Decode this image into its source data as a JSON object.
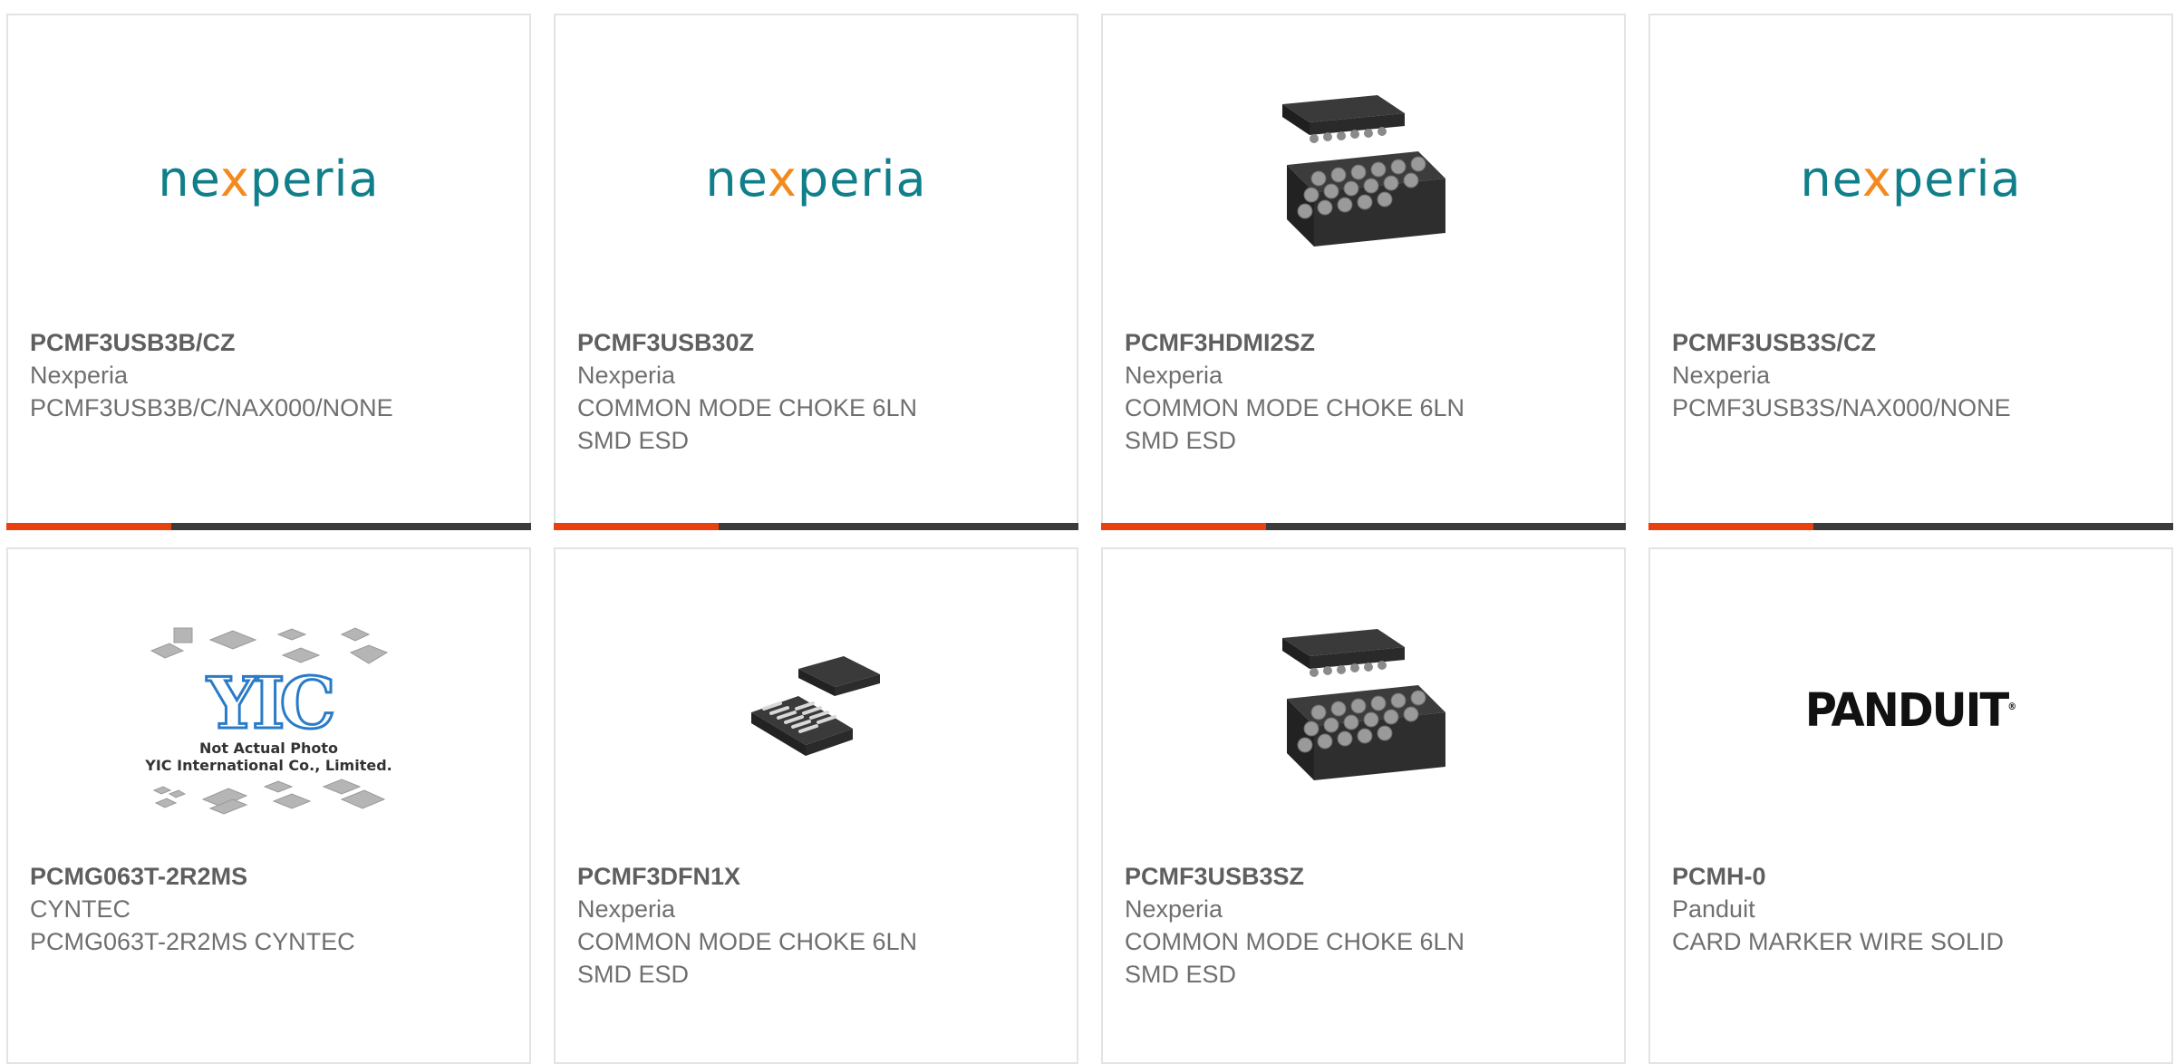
{
  "products": [
    {
      "part_number": "PCMF3USB3B/CZ",
      "manufacturer": "Nexperia",
      "description": "PCMF3USB3B/C/NAX000/NONE",
      "image": "nexperia-logo"
    },
    {
      "part_number": "PCMF3USB30Z",
      "manufacturer": "Nexperia",
      "description": "COMMON MODE CHOKE 6LN SMD ESD",
      "image": "nexperia-logo"
    },
    {
      "part_number": "PCMF3HDMI2SZ",
      "manufacturer": "Nexperia",
      "description": "COMMON MODE CHOKE 6LN SMD ESD",
      "image": "bga-package-photo"
    },
    {
      "part_number": "PCMF3USB3S/CZ",
      "manufacturer": "Nexperia",
      "description": "PCMF3USB3S/NAX000/NONE",
      "image": "nexperia-logo"
    },
    {
      "part_number": "PCMG063T-2R2MS",
      "manufacturer": "CYNTEC",
      "description": "PCMG063T-2R2MS CYNTEC",
      "image": "yic-placeholder"
    },
    {
      "part_number": "PCMF3DFN1X",
      "manufacturer": "Nexperia",
      "description": "COMMON MODE CHOKE 6LN SMD ESD",
      "image": "dfn-package-photo"
    },
    {
      "part_number": "PCMF3USB3SZ",
      "manufacturer": "Nexperia",
      "description": "COMMON MODE CHOKE 6LN SMD ESD",
      "image": "bga-package-photo"
    },
    {
      "part_number": "PCMH-0",
      "manufacturer": "Panduit",
      "description": "CARD MARKER WIRE SOLID",
      "image": "panduit-logo"
    }
  ],
  "logos": {
    "nexperia_pre": "ne",
    "nexperia_x": "x",
    "nexperia_post": "peria",
    "panduit": "PANDUIT",
    "panduit_tm": "®",
    "yic_mark": "YIC",
    "yic_note_line1": "Not Actual Photo",
    "yic_note_line2": "YIC International Co., Limited."
  },
  "colors": {
    "accent": "#e8400f",
    "bar_dark": "#3b3b3b",
    "card_border": "#e3e3e3",
    "text_primary": "#5f5f5f",
    "text_secondary": "#6f6f6f",
    "nexperia_teal": "#107f8a",
    "nexperia_orange": "#f28a1e"
  }
}
